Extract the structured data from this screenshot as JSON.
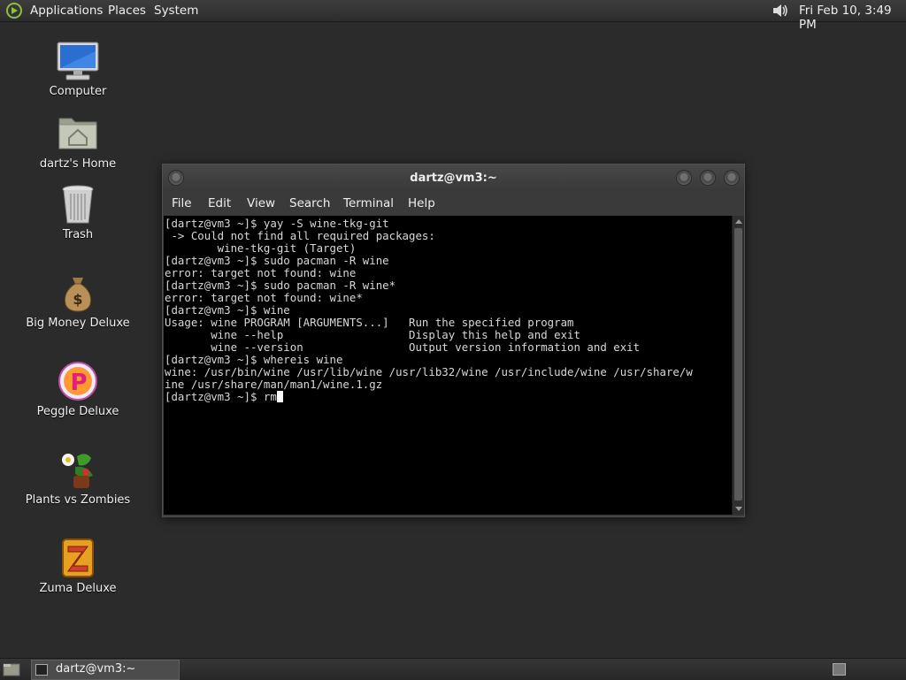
{
  "top_panel": {
    "menus": [
      "Applications",
      "Places",
      "System"
    ],
    "clock": "Fri Feb 10,  3:49 PM"
  },
  "desktop_icons": [
    {
      "label": "Computer",
      "icon": "computer-icon"
    },
    {
      "label": "dartz's Home",
      "icon": "home-folder-icon"
    },
    {
      "label": "Trash",
      "icon": "trash-icon"
    },
    {
      "label": "Big Money Deluxe",
      "icon": "money-bag-icon"
    },
    {
      "label": "Peggle Deluxe",
      "icon": "peggle-icon"
    },
    {
      "label": "Plants vs Zombies",
      "icon": "plants-vs-zombies-icon"
    },
    {
      "label": "Zuma Deluxe",
      "icon": "zuma-icon"
    }
  ],
  "terminal": {
    "title": "dartz@vm3:~",
    "menu": [
      "File",
      "Edit",
      "View",
      "Search",
      "Terminal",
      "Help"
    ],
    "lines": [
      "[dartz@vm3 ~]$ yay -S wine-tkg-git",
      " -> Could not find all required packages:",
      "        wine-tkg-git (Target)",
      "[dartz@vm3 ~]$ sudo pacman -R wine",
      "error: target not found: wine",
      "[dartz@vm3 ~]$ sudo pacman -R wine*",
      "error: target not found: wine*",
      "[dartz@vm3 ~]$ wine",
      "Usage: wine PROGRAM [ARGUMENTS...]   Run the specified program",
      "       wine --help                   Display this help and exit",
      "       wine --version                Output version information and exit",
      "[dartz@vm3 ~]$ whereis wine",
      "wine: /usr/bin/wine /usr/lib/wine /usr/lib32/wine /usr/include/wine /usr/share/w",
      "ine /usr/share/man/man1/wine.1.gz"
    ],
    "prompt": "[dartz@vm3 ~]$ ",
    "current_input": "rm"
  },
  "taskbar": {
    "window_button": "dartz@vm3:~"
  }
}
